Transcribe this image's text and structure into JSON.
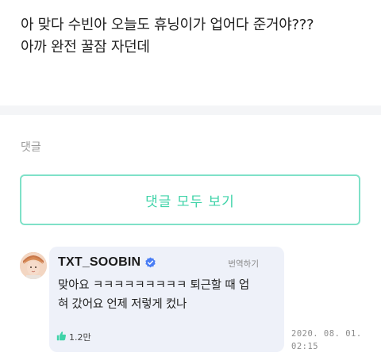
{
  "post": {
    "line1": "아 맞다 수빈아 오늘도 휴닝이가 업어다 준거야???",
    "line2": "아까 완전 꿀잠 자던데"
  },
  "comments_section": {
    "label": "댓글",
    "view_all_button": "댓글 모두 보기"
  },
  "comment": {
    "author": "TXT_SOOBIN",
    "verified": true,
    "translate_label": "번역하기",
    "body_line1": "맞아요 ㅋㅋㅋㅋㅋㅋㅋㅋㅋ 퇴근할 때 업",
    "body_line2": "혀 갔어요 언제 저렇게 컸나",
    "like_count": "1.2만",
    "date": "2020. 08. 01.",
    "time": "02:15"
  },
  "colors": {
    "accent": "#3fd3a8",
    "verified": "#4a7ef5",
    "bubble": "#eef1f9",
    "like_icon": "#3fd3a8"
  },
  "icons": {
    "verified": "verified-badge-icon",
    "like": "thumbs-up-icon"
  }
}
